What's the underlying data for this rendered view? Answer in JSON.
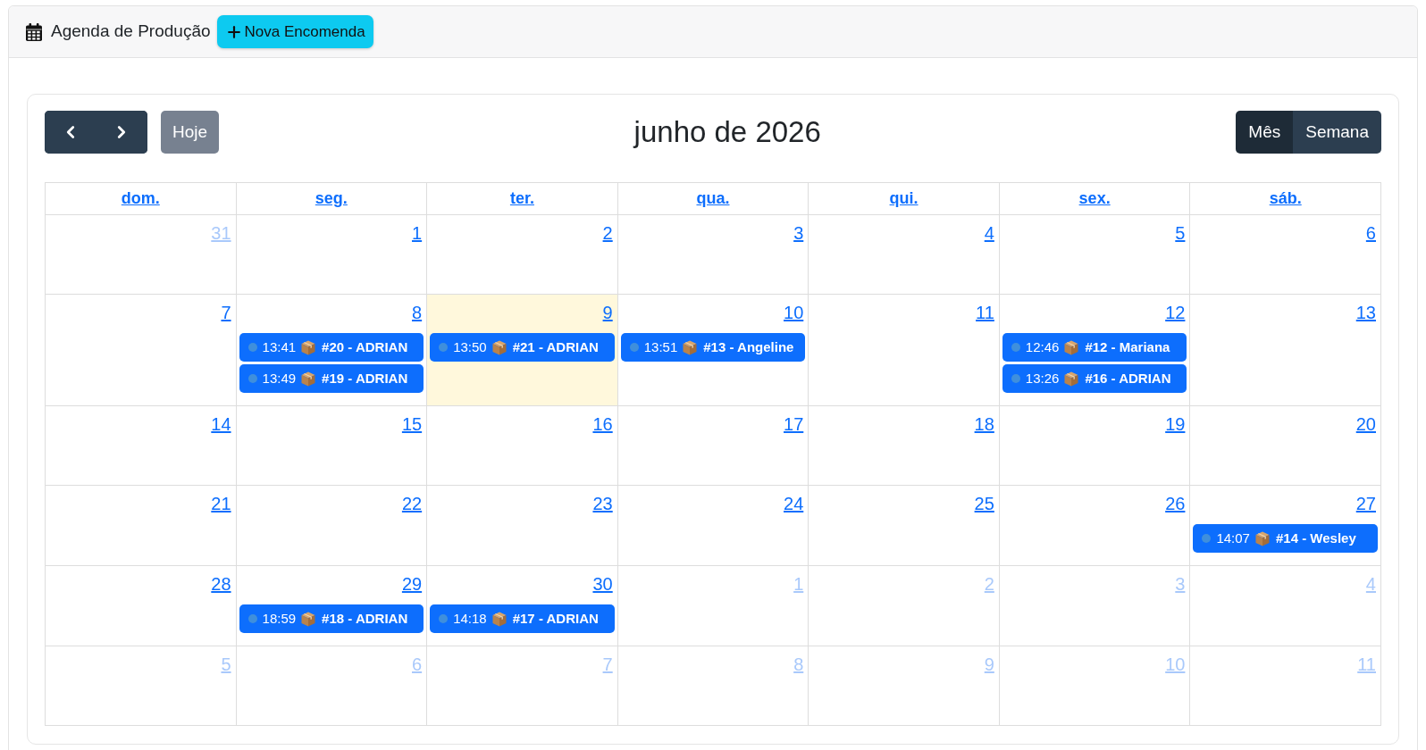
{
  "header": {
    "title": "Agenda de Produção",
    "new_order_button": "Nova Encomenda"
  },
  "toolbar": {
    "today_button": {
      "label": "Hoje",
      "disabled": true
    },
    "title": "junho de 2026",
    "views": [
      {
        "label": "Mês",
        "selected": true
      },
      {
        "label": "Semana",
        "selected": false
      }
    ]
  },
  "calendar": {
    "weekdays": [
      "dom.",
      "seg.",
      "ter.",
      "qua.",
      "qui.",
      "sex.",
      "sáb."
    ],
    "weeks": [
      {
        "days": [
          {
            "date": "31",
            "other_month": true,
            "today": false
          },
          {
            "date": "1",
            "other_month": false,
            "today": false
          },
          {
            "date": "2",
            "other_month": false,
            "today": false
          },
          {
            "date": "3",
            "other_month": false,
            "today": false
          },
          {
            "date": "4",
            "other_month": false,
            "today": false
          },
          {
            "date": "5",
            "other_month": false,
            "today": false
          },
          {
            "date": "6",
            "other_month": false,
            "today": false
          }
        ]
      },
      {
        "days": [
          {
            "date": "7",
            "other_month": false,
            "today": false
          },
          {
            "date": "8",
            "other_month": false,
            "today": false,
            "events": [
              {
                "time": "13:41",
                "title": "#20 - ADRIAN"
              },
              {
                "time": "13:49",
                "title": "#19 - ADRIAN"
              }
            ]
          },
          {
            "date": "9",
            "other_month": false,
            "today": true,
            "events": [
              {
                "time": "13:50",
                "title": "#21 - ADRIAN"
              }
            ]
          },
          {
            "date": "10",
            "other_month": false,
            "today": false,
            "events": [
              {
                "time": "13:51",
                "title": "#13 - Angeline"
              }
            ]
          },
          {
            "date": "11",
            "other_month": false,
            "today": false
          },
          {
            "date": "12",
            "other_month": false,
            "today": false,
            "events": [
              {
                "time": "12:46",
                "title": "#12 - Mariana"
              },
              {
                "time": "13:26",
                "title": "#16 - ADRIAN"
              }
            ]
          },
          {
            "date": "13",
            "other_month": false,
            "today": false
          }
        ]
      },
      {
        "days": [
          {
            "date": "14",
            "other_month": false,
            "today": false
          },
          {
            "date": "15",
            "other_month": false,
            "today": false
          },
          {
            "date": "16",
            "other_month": false,
            "today": false
          },
          {
            "date": "17",
            "other_month": false,
            "today": false
          },
          {
            "date": "18",
            "other_month": false,
            "today": false
          },
          {
            "date": "19",
            "other_month": false,
            "today": false
          },
          {
            "date": "20",
            "other_month": false,
            "today": false
          }
        ]
      },
      {
        "days": [
          {
            "date": "21",
            "other_month": false,
            "today": false
          },
          {
            "date": "22",
            "other_month": false,
            "today": false
          },
          {
            "date": "23",
            "other_month": false,
            "today": false
          },
          {
            "date": "24",
            "other_month": false,
            "today": false
          },
          {
            "date": "25",
            "other_month": false,
            "today": false
          },
          {
            "date": "26",
            "other_month": false,
            "today": false
          },
          {
            "date": "27",
            "other_month": false,
            "today": false,
            "events": [
              {
                "time": "14:07",
                "title": "#14 - Wesley"
              }
            ]
          }
        ]
      },
      {
        "days": [
          {
            "date": "28",
            "other_month": false,
            "today": false
          },
          {
            "date": "29",
            "other_month": false,
            "today": false,
            "events": [
              {
                "time": "18:59",
                "title": "#18 - ADRIAN"
              }
            ]
          },
          {
            "date": "30",
            "other_month": false,
            "today": false,
            "events": [
              {
                "time": "14:18",
                "title": "#17 - ADRIAN"
              }
            ]
          },
          {
            "date": "1",
            "other_month": true,
            "today": false
          },
          {
            "date": "2",
            "other_month": true,
            "today": false
          },
          {
            "date": "3",
            "other_month": true,
            "today": false
          },
          {
            "date": "4",
            "other_month": true,
            "today": false
          }
        ]
      },
      {
        "days": [
          {
            "date": "5",
            "other_month": true,
            "today": false
          },
          {
            "date": "6",
            "other_month": true,
            "today": false
          },
          {
            "date": "7",
            "other_month": true,
            "today": false
          },
          {
            "date": "8",
            "other_month": true,
            "today": false
          },
          {
            "date": "9",
            "other_month": true,
            "today": false
          },
          {
            "date": "10",
            "other_month": true,
            "today": false
          },
          {
            "date": "11",
            "other_month": true,
            "today": false
          }
        ]
      }
    ]
  }
}
